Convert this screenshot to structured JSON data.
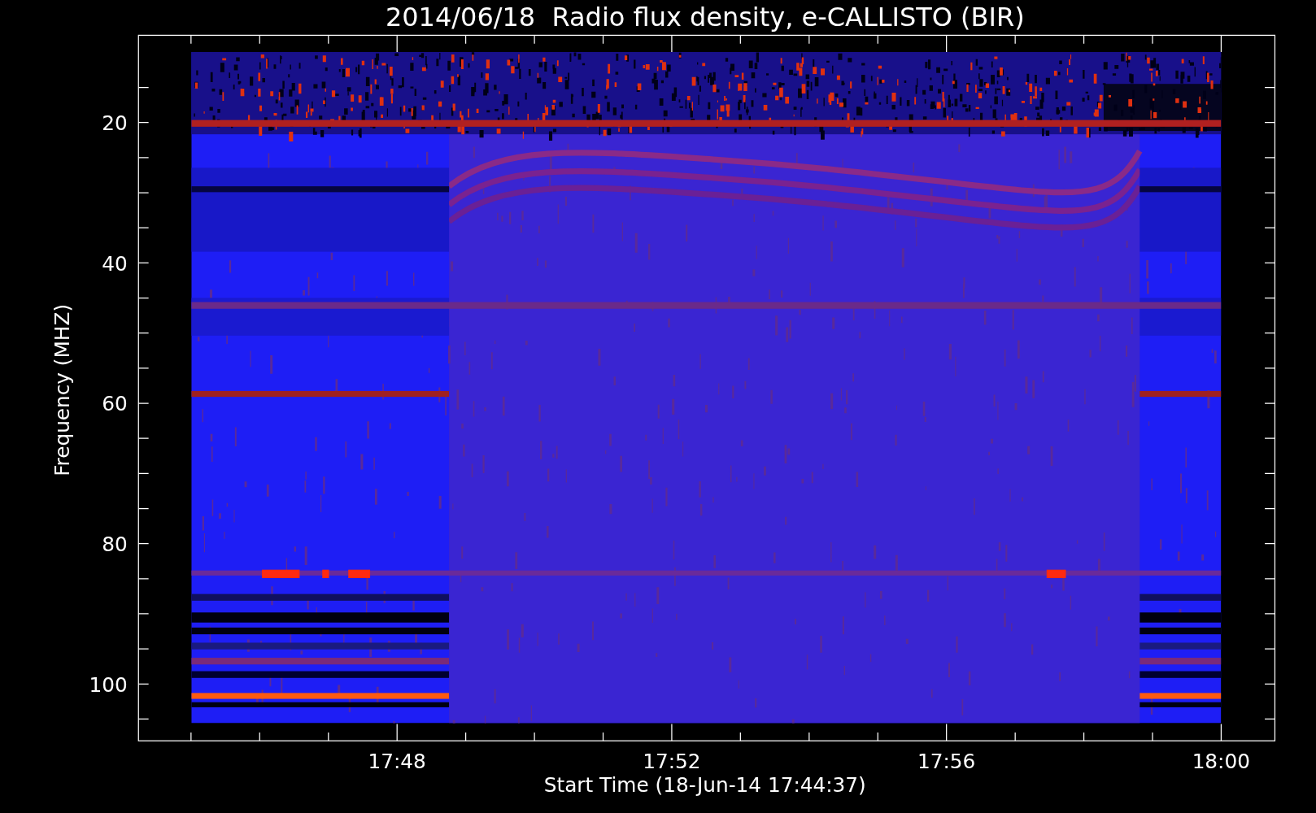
{
  "title": "2014/06/18  Radio flux density, e-CALLISTO (BIR)",
  "y_axis": {
    "label": "Frequency (MHZ)",
    "ticks": [
      "20",
      "40",
      "60",
      "80",
      "100"
    ]
  },
  "x_axis": {
    "label": "Start Time (18-Jun-14 17:44:37)",
    "ticks": [
      "17:48",
      "17:52",
      "17:56",
      "18:00"
    ]
  }
}
